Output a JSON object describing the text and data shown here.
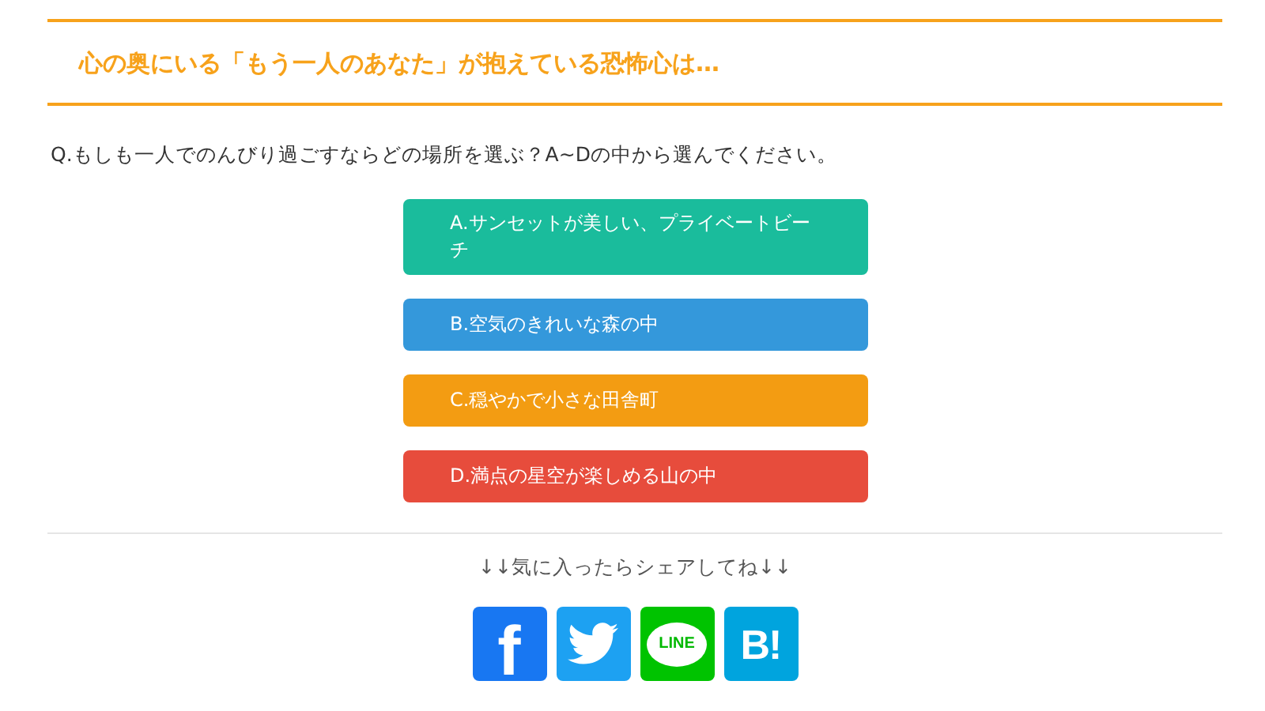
{
  "heading": "心の奥にいる「もう一人のあなた」が抱えている恐怖心は…",
  "question": "Q.もしも一人でのんびり過ごすならどの場所を選ぶ？A~Dの中から選んでください。",
  "answers": [
    {
      "label": "A.サンセットが美しい、プライベートビーチ",
      "color": "#1abc9c"
    },
    {
      "label": "B.空気のきれいな森の中",
      "color": "#3498db"
    },
    {
      "label": "C.穏やかで小さな田舎町",
      "color": "#f39c12"
    },
    {
      "label": "D.満点の星空が楽しめる山の中",
      "color": "#e74c3c"
    }
  ],
  "share_prompt": "↓↓気に入ったらシェアしてね↓↓",
  "share_buttons": [
    {
      "kind": "facebook",
      "label": "f"
    },
    {
      "kind": "twitter"
    },
    {
      "kind": "line",
      "label": "LINE"
    },
    {
      "kind": "hatena",
      "label": "B!"
    }
  ]
}
